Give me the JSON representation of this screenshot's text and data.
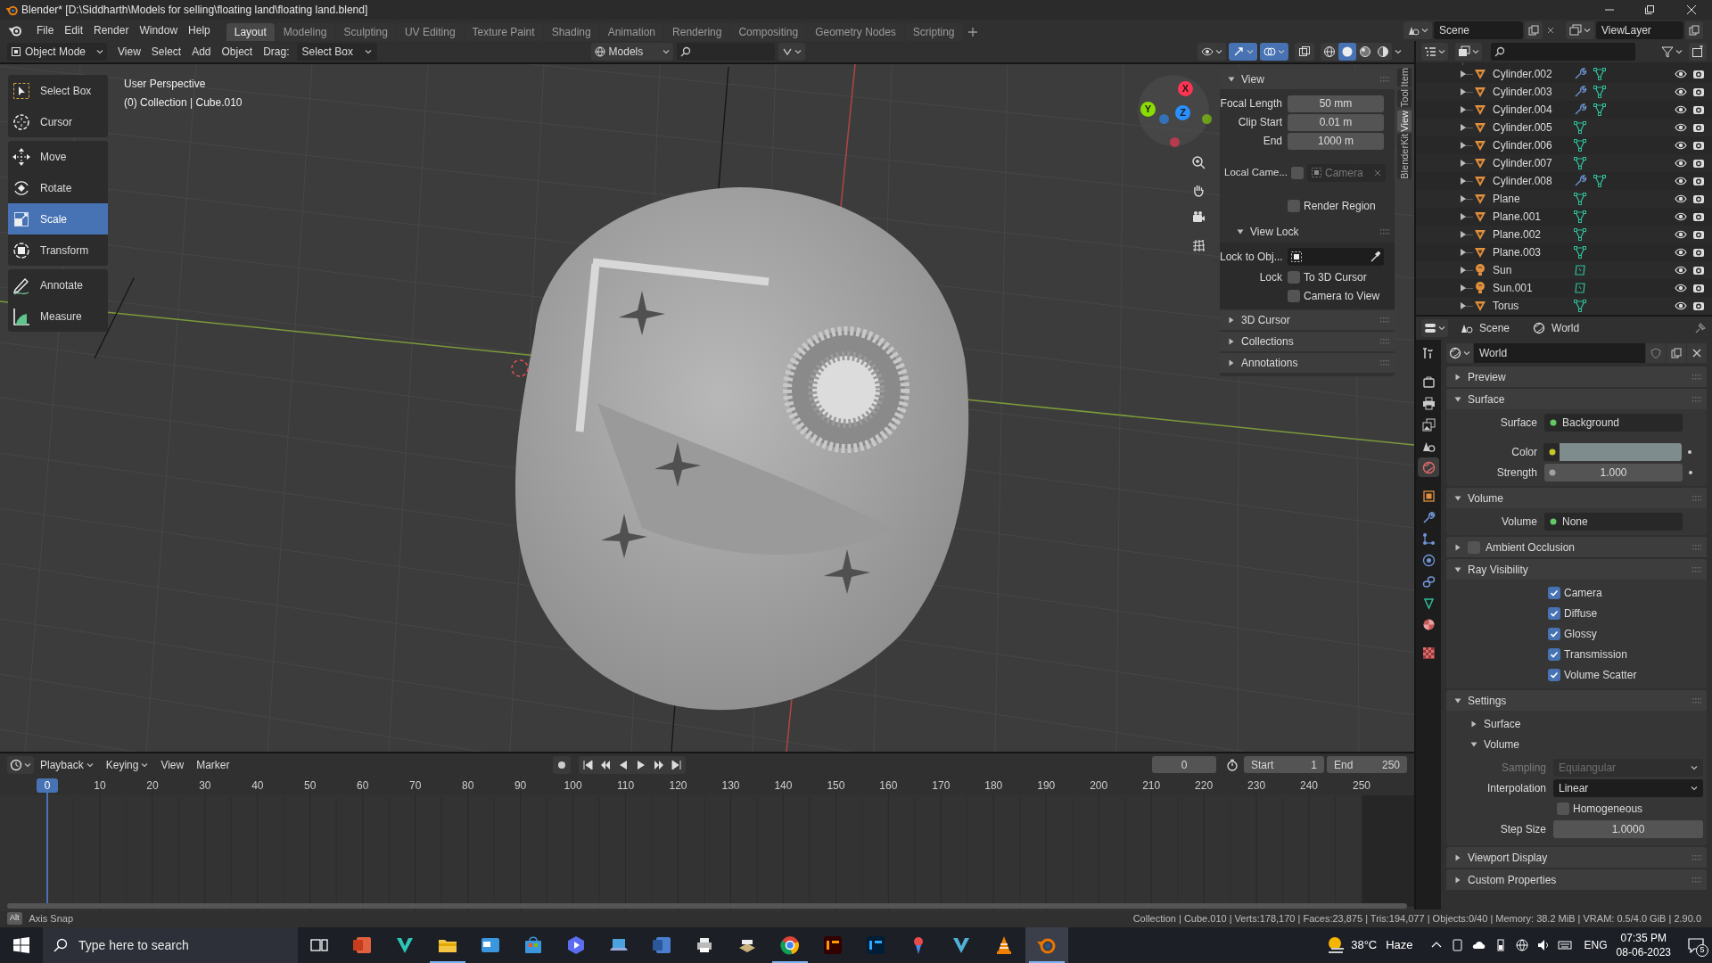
{
  "title_bar": {
    "title": "Blender* [D:\\Siddharth\\Models for selling\\floating land\\floating land.blend]"
  },
  "menu": [
    "File",
    "Edit",
    "Render",
    "Window",
    "Help"
  ],
  "workspaces": [
    {
      "label": "Layout",
      "selected": true
    },
    {
      "label": "Modeling",
      "selected": false
    },
    {
      "label": "Sculpting",
      "selected": false
    },
    {
      "label": "UV Editing",
      "selected": false
    },
    {
      "label": "Texture Paint",
      "selected": false
    },
    {
      "label": "Shading",
      "selected": false
    },
    {
      "label": "Animation",
      "selected": false
    },
    {
      "label": "Rendering",
      "selected": false
    },
    {
      "label": "Compositing",
      "selected": false
    },
    {
      "label": "Geometry Nodes",
      "selected": false
    },
    {
      "label": "Scripting",
      "selected": false
    }
  ],
  "scene": "Scene",
  "view_layer": "ViewLayer",
  "viewport_header": {
    "mode": "Object Mode",
    "menus": [
      "View",
      "Select",
      "Add",
      "Object"
    ],
    "drag_label": "Drag:",
    "drag_value": "Select Box",
    "orientation": "Models",
    "shading": [
      {
        "selected": false
      },
      {
        "selected": true
      },
      {
        "selected": false
      },
      {
        "selected": false
      }
    ]
  },
  "viewport": {
    "perspective": "User Perspective",
    "context": "(0) Collection | Cube.010",
    "tool_groups": [
      [
        {
          "label": "Select Box",
          "selected": false
        },
        {
          "label": "Cursor",
          "selected": false
        }
      ],
      [
        {
          "label": "Move",
          "selected": false
        },
        {
          "label": "Rotate",
          "selected": false
        },
        {
          "label": "Scale",
          "selected": true
        },
        {
          "label": "Transform",
          "selected": false
        }
      ],
      [
        {
          "label": "Annotate",
          "selected": false
        },
        {
          "label": "Measure",
          "selected": false
        }
      ]
    ],
    "gizmo": [
      {
        "label": "X",
        "color": "#ff3352"
      },
      {
        "label": "Y",
        "color": "#8bdc00"
      },
      {
        "label": "Z",
        "color": "#2890ff"
      }
    ]
  },
  "sidebar": {
    "tabs": [
      {
        "label": "Item",
        "selected": false
      },
      {
        "label": "Tool",
        "selected": false
      },
      {
        "label": "View",
        "selected": true
      },
      {
        "label": "BlenderKit",
        "selected": false
      }
    ],
    "view": {
      "title": "View",
      "expanded": true,
      "fields": [
        {
          "label": "Focal Length",
          "value": "50 mm"
        },
        {
          "label": "Clip Start",
          "value": "0.01 m"
        },
        {
          "label": "End",
          "value": "1000 m"
        }
      ],
      "local_camera": {
        "label": "Local Came...",
        "checked": false,
        "placeholder": "Camera"
      },
      "render_region": {
        "label": "Render Region",
        "checked": false
      },
      "view_lock": {
        "title": "View Lock",
        "expanded": true,
        "lock_to_object": "Lock to Obj...",
        "lock_label": "Lock",
        "options": [
          {
            "label": "To 3D Cursor",
            "checked": false
          },
          {
            "label": "Camera to View",
            "checked": false
          }
        ]
      }
    },
    "panels": [
      {
        "title": "3D Cursor",
        "expanded": false
      },
      {
        "title": "Collections",
        "expanded": false
      },
      {
        "title": "Annotations",
        "expanded": false
      }
    ]
  },
  "outliner": {
    "rows": [
      {
        "name": "Cylinder.002",
        "kind": "mesh",
        "modifier": true
      },
      {
        "name": "Cylinder.003",
        "kind": "mesh",
        "modifier": true
      },
      {
        "name": "Cylinder.004",
        "kind": "mesh",
        "modifier": true
      },
      {
        "name": "Cylinder.005",
        "kind": "mesh",
        "modifier": false
      },
      {
        "name": "Cylinder.006",
        "kind": "mesh",
        "modifier": false
      },
      {
        "name": "Cylinder.007",
        "kind": "mesh",
        "modifier": false
      },
      {
        "name": "Cylinder.008",
        "kind": "mesh",
        "modifier": true
      },
      {
        "name": "Plane",
        "kind": "mesh",
        "modifier": false
      },
      {
        "name": "Plane.001",
        "kind": "mesh",
        "modifier": false
      },
      {
        "name": "Plane.002",
        "kind": "mesh",
        "modifier": false
      },
      {
        "name": "Plane.003",
        "kind": "mesh",
        "modifier": false
      },
      {
        "name": "Sun",
        "kind": "light",
        "modifier": false
      },
      {
        "name": "Sun.001",
        "kind": "light",
        "modifier": false
      },
      {
        "name": "Torus",
        "kind": "mesh",
        "modifier": false
      }
    ]
  },
  "properties": {
    "breadcrumbs": [
      "Scene",
      "World"
    ],
    "side_tabs": [
      {
        "kind": "tool",
        "selected": false
      },
      {
        "kind": "render",
        "selected": false
      },
      {
        "kind": "output",
        "selected": false
      },
      {
        "kind": "view_layer",
        "selected": false
      },
      {
        "kind": "scene",
        "selected": false
      },
      {
        "kind": "world",
        "selected": true
      },
      {
        "kind": "object",
        "selected": false
      },
      {
        "kind": "modifier",
        "selected": false
      },
      {
        "kind": "particles",
        "selected": false
      },
      {
        "kind": "physics",
        "selected": false
      },
      {
        "kind": "constraints",
        "selected": false
      },
      {
        "kind": "data",
        "selected": false
      },
      {
        "kind": "material",
        "selected": false
      },
      {
        "kind": "texture",
        "selected": false
      }
    ],
    "datablock": "World",
    "panels": [
      {
        "title": "Preview",
        "expanded": false
      },
      {
        "title": "Surface",
        "expanded": true,
        "rows": [
          {
            "kind": "link",
            "label": "Surface",
            "value": "Background"
          },
          {
            "kind": "color",
            "label": "Color"
          },
          {
            "kind": "number",
            "label": "Strength",
            "value": "1.000"
          }
        ]
      },
      {
        "title": "Volume",
        "expanded": true,
        "rows": [
          {
            "kind": "link",
            "label": "Volume",
            "value": "None"
          }
        ]
      },
      {
        "title": "Ambient Occlusion",
        "expanded": false,
        "checked": false
      },
      {
        "title": "Ray Visibility",
        "expanded": true,
        "rows": [
          {
            "kind": "check",
            "label": "Camera",
            "checked": true
          },
          {
            "kind": "check",
            "label": "Diffuse",
            "checked": true
          },
          {
            "kind": "check",
            "label": "Glossy",
            "checked": true
          },
          {
            "kind": "check",
            "label": "Transmission",
            "checked": true
          },
          {
            "kind": "check",
            "label": "Volume Scatter",
            "checked": true
          }
        ]
      },
      {
        "title": "Settings",
        "expanded": true,
        "subpanels": [
          {
            "title": "Surface",
            "expanded": false
          },
          {
            "title": "Volume",
            "expanded": true,
            "rows": [
              {
                "kind": "dropdown",
                "label": "Sampling",
                "value": "Equiangular",
                "disabled": true
              },
              {
                "kind": "dropdown",
                "label": "Interpolation",
                "value": "Linear",
                "disabled": false
              },
              {
                "kind": "check",
                "label": "Homogeneous",
                "checked": false
              },
              {
                "kind": "number",
                "label": "Step Size",
                "value": "1.0000"
              }
            ]
          }
        ]
      },
      {
        "title": "Viewport Display",
        "expanded": false
      },
      {
        "title": "Custom Properties",
        "expanded": false
      }
    ]
  },
  "timeline": {
    "menus": [
      "Playback",
      "Keying",
      "View",
      "Marker"
    ],
    "current_frame": "0",
    "start_label": "Start",
    "start": "1",
    "end_label": "End",
    "end": "250",
    "ruler": [
      {
        "label": "0",
        "selected": true
      },
      {
        "label": "10",
        "selected": false
      },
      {
        "label": "20",
        "selected": false
      },
      {
        "label": "30",
        "selected": false
      },
      {
        "label": "40",
        "selected": false
      },
      {
        "label": "50",
        "selected": false
      },
      {
        "label": "60",
        "selected": false
      },
      {
        "label": "70",
        "selected": false
      },
      {
        "label": "80",
        "selected": false
      },
      {
        "label": "90",
        "selected": false
      },
      {
        "label": "100",
        "selected": false
      },
      {
        "label": "110",
        "selected": false
      },
      {
        "label": "120",
        "selected": false
      },
      {
        "label": "130",
        "selected": false
      },
      {
        "label": "140",
        "selected": false
      },
      {
        "label": "150",
        "selected": false
      },
      {
        "label": "160",
        "selected": false
      },
      {
        "label": "170",
        "selected": false
      },
      {
        "label": "180",
        "selected": false
      },
      {
        "label": "190",
        "selected": false
      },
      {
        "label": "200",
        "selected": false
      },
      {
        "label": "210",
        "selected": false
      },
      {
        "label": "220",
        "selected": false
      },
      {
        "label": "230",
        "selected": false
      },
      {
        "label": "240",
        "selected": false
      },
      {
        "label": "250",
        "selected": false
      }
    ]
  },
  "status_bar": {
    "key": "Alt",
    "hint": "Axis Snap",
    "stats": "Collection | Cube.010 | Verts:178,170 | Faces:23,875 | Tris:194,077 | Objects:0/40 | Memory: 38.2 MiB | VRAM: 0.5/4.0 GiB | 2.90.0"
  },
  "taskbar": {
    "search_placeholder": "Type here to search",
    "apps": [
      {
        "open": false,
        "selected": false
      },
      {
        "open": false,
        "selected": false
      },
      {
        "open": false,
        "selected": false
      },
      {
        "open": true,
        "selected": false
      },
      {
        "open": false,
        "selected": false
      },
      {
        "open": false,
        "selected": false
      },
      {
        "open": false,
        "selected": false
      },
      {
        "open": false,
        "selected": false
      },
      {
        "open": false,
        "selected": false
      },
      {
        "open": false,
        "selected": false
      },
      {
        "open": false,
        "selected": false
      },
      {
        "open": true,
        "selected": false
      },
      {
        "open": false,
        "selected": false
      },
      {
        "open": false,
        "selected": false
      },
      {
        "open": false,
        "selected": false
      },
      {
        "open": false,
        "selected": false
      },
      {
        "open": false,
        "selected": false
      },
      {
        "open": true,
        "selected": true
      }
    ],
    "temperature": "38°C",
    "weather": "Haze",
    "language": "ENG",
    "time": "07:35 PM",
    "date": "08-06-2023",
    "notifications": "5"
  }
}
